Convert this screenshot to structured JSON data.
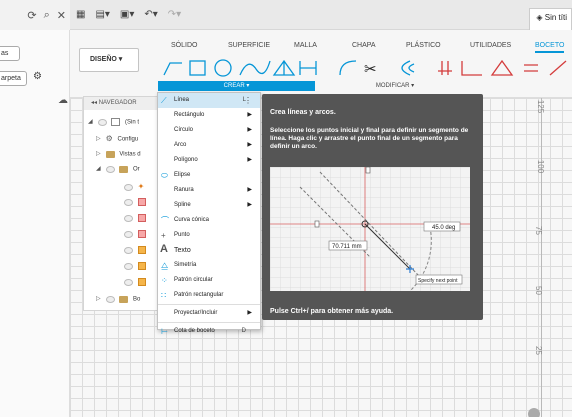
{
  "left_panel": {
    "field1": "as",
    "field2": "arpeta"
  },
  "doc_tab": "Sin títi",
  "ribbon": {
    "design_label": "DISEÑO ▾",
    "tabs": [
      "SÓLIDO",
      "SUPERFICIE",
      "MALLA",
      "CHAPA",
      "PLÁSTICO",
      "UTILIDADES",
      "BOCETO"
    ],
    "group_crear": "CREAR ▾",
    "group_modificar": "MODIFICAR ▾"
  },
  "browser": {
    "header": "◂◂ NAVEGADOR",
    "root": "(Sin t",
    "items": [
      "Configu",
      "Vistas d",
      "Or",
      "Bo"
    ]
  },
  "menu": {
    "items": [
      {
        "label": "Línea",
        "shortcut": "L"
      },
      {
        "label": "Rectángulo"
      },
      {
        "label": "Círculo"
      },
      {
        "label": "Arco"
      },
      {
        "label": "Polígono"
      },
      {
        "label": "Elipse"
      },
      {
        "label": "Ranura"
      },
      {
        "label": "Spline"
      },
      {
        "label": "Curva cónica"
      },
      {
        "label": "Punto"
      },
      {
        "label": "Texto"
      },
      {
        "label": "Simetría"
      },
      {
        "label": "Patrón circular"
      },
      {
        "label": "Patrón rectangular"
      },
      {
        "label": "Proyectar/Incluir"
      },
      {
        "label": "Cota de boceto",
        "shortcut": "D"
      }
    ]
  },
  "tooltip": {
    "title": "Crea líneas y arcos.",
    "description": "Seleccione los puntos inicial y final para definir un segmento de línea. Haga clic y arrastre el punto final de un segmento para definir un arco.",
    "preview": {
      "dim_length": "70.711 mm",
      "dim_angle": "45.0 deg",
      "prompt": "Specify next point"
    },
    "hint": "Pulse Ctrl+/ para obtener más ayuda."
  },
  "ruler": [
    "125",
    "100",
    "75",
    "50",
    "25"
  ]
}
